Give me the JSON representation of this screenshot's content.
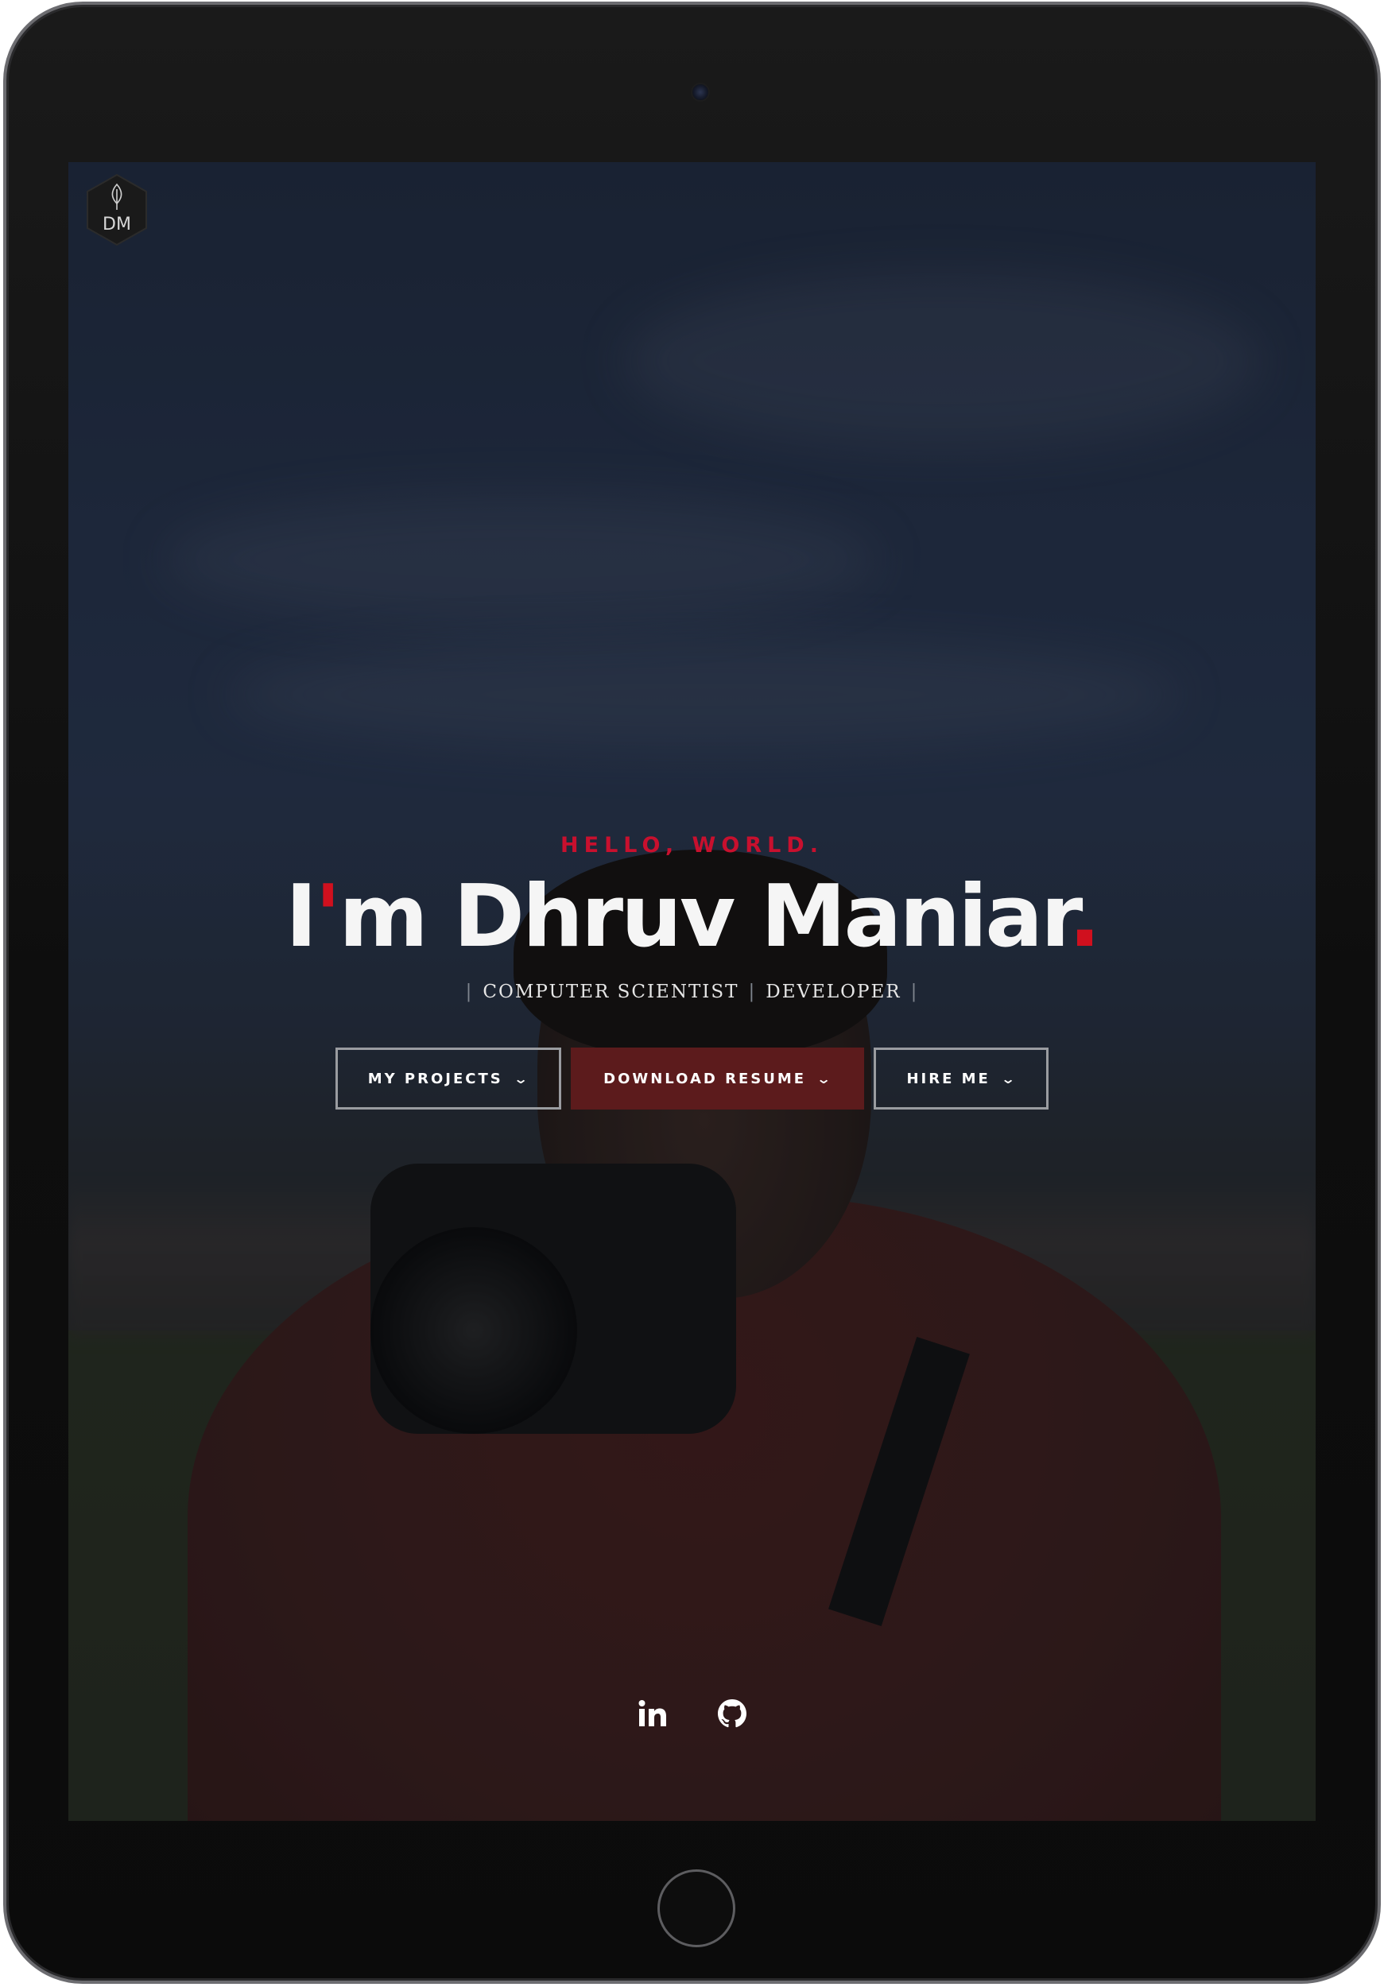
{
  "logo": {
    "text": "DM"
  },
  "hero": {
    "greeting": "HELLO, WORLD.",
    "title_prefix": "I",
    "title_apostrophe": "'",
    "title_main": "m Dhruv Maniar",
    "title_period": ".",
    "roles": [
      "COMPUTER SCIENTIST",
      "DEVELOPER"
    ]
  },
  "actions": {
    "projects_label": "MY PROJECTS",
    "resume_label": "DOWNLOAD RESUME",
    "hire_label": "HIRE ME"
  },
  "social": {
    "linkedin_icon": "linkedin-icon",
    "github_icon": "github-icon"
  },
  "colors": {
    "accent": "#c8102e",
    "primary_button": "#5c1b1c",
    "text": "#f5f5f5"
  }
}
